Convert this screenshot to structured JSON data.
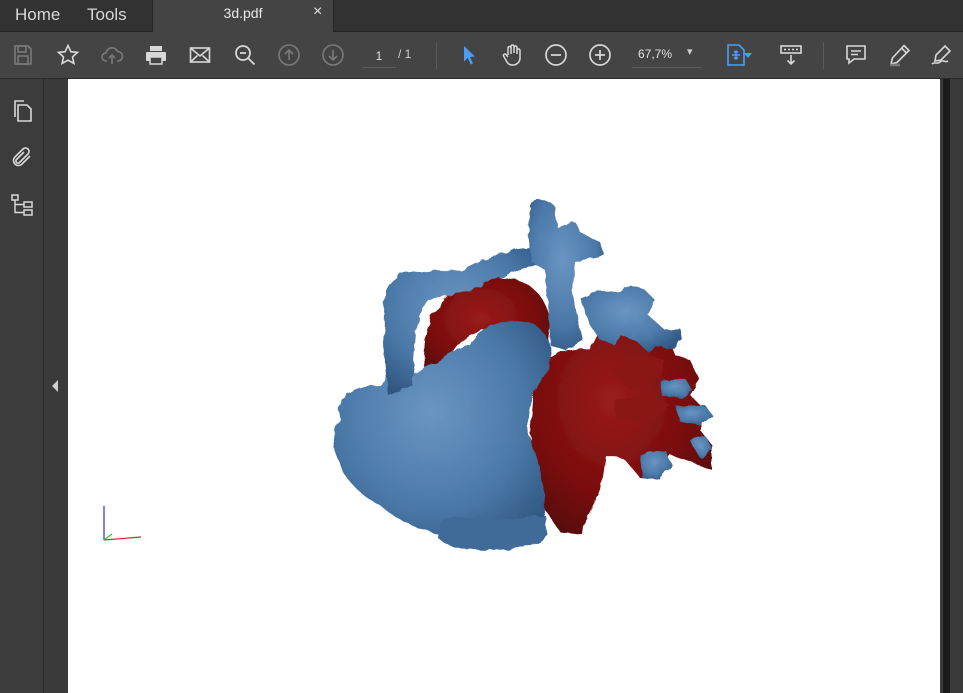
{
  "tabs": {
    "home": "Home",
    "tools": "Tools",
    "document": "3d.pdf",
    "close_glyph": "×"
  },
  "toolbar": {
    "icons": [
      "save-icon",
      "bookmark-star-icon",
      "upload-cloud-icon",
      "print-icon",
      "email-icon",
      "search-zoom-icon",
      "page-up-icon",
      "page-down-icon",
      "select-cursor-icon",
      "hand-icon",
      "zoom-out-icon",
      "zoom-in-icon",
      "fit-page-icon",
      "scroll-mode-icon",
      "comment-icon",
      "highlight-pen-icon",
      "sign-icon"
    ],
    "current_page": "1",
    "total_pages": "/ 1",
    "zoom": "67,7%",
    "zoom_caret": "▾"
  },
  "sidebar": {
    "icons": [
      "pages-icon",
      "attachments-icon",
      "layers-icon"
    ]
  },
  "colors": {
    "accent": "#4a9ff5",
    "model_blue": "#4b79a8",
    "model_red": "#7a0d0d"
  }
}
